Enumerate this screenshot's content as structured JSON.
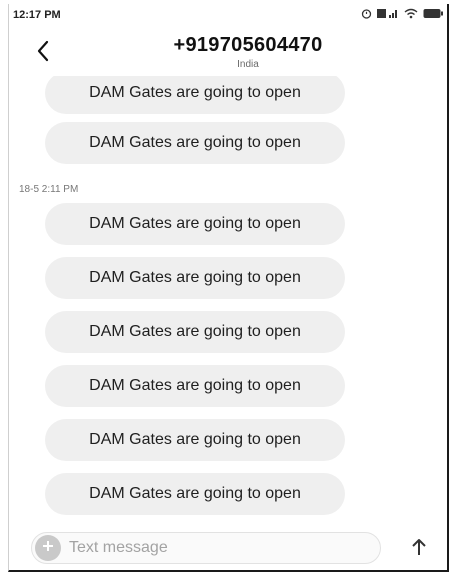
{
  "status_bar": {
    "time": "12:17 PM"
  },
  "header": {
    "contact_number": "+919705604470",
    "contact_country": "India",
    "back_icon": "chevron-left-icon"
  },
  "conversation": {
    "messages_before": [
      {
        "text": "DAM Gates are going to open"
      },
      {
        "text": "DAM Gates are going to open"
      }
    ],
    "timestamp": "18-5 2:11 PM",
    "messages_after": [
      {
        "text": "DAM Gates are going to open"
      },
      {
        "text": "DAM Gates are going to open"
      },
      {
        "text": "DAM Gates are going to open"
      },
      {
        "text": "DAM Gates are going to open"
      },
      {
        "text": "DAM Gates are going to open"
      },
      {
        "text": "DAM Gates are going to open"
      }
    ]
  },
  "compose": {
    "placeholder": "Text message",
    "add_icon": "plus-icon",
    "send_icon": "arrow-up-icon"
  },
  "colors": {
    "bubble_background": "#efefef",
    "add_button": "#c9c9c9"
  }
}
